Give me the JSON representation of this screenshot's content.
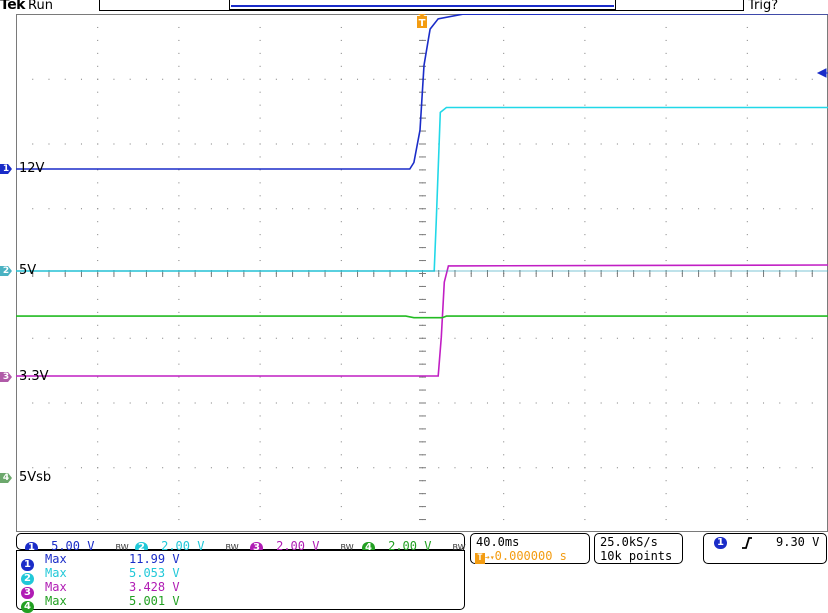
{
  "header": {
    "brand": "Tek",
    "state": "Run",
    "trigger_status": "Trig?"
  },
  "colors": {
    "ch1": "#1a2cc8",
    "ch2": "#21d8e8",
    "ch3": "#c11ec4",
    "ch4": "#22bb22",
    "trigger": "#f39c12",
    "grid": "#7a7a7a"
  },
  "icons": {
    "trigger_marker": "trigger-t-icon",
    "ref_arrow": "left-arrow-icon",
    "edge": "rising-edge-icon"
  },
  "channels": [
    {
      "num": "1",
      "label": "12V",
      "scale": "5.00 V",
      "bw": "BW",
      "color": "#1a2cc8"
    },
    {
      "num": "2",
      "label": "5V",
      "scale": "2.00 V",
      "bw": "BW",
      "color": "#21c8d8"
    },
    {
      "num": "3",
      "label": "3.3V",
      "scale": "2.00 V",
      "bw": "BW",
      "color": "#b01cb4"
    },
    {
      "num": "4",
      "label": "5Vsb",
      "scale": "2.00 V",
      "bw": "BW",
      "color": "#22a022"
    }
  ],
  "timebase": {
    "scale": "40.0ms",
    "trigger_marker": "T",
    "position": "0.000000 s"
  },
  "acquisition": {
    "rate": "25.0kS/s",
    "length": "10k points"
  },
  "trigger": {
    "source": "1",
    "level": "9.30 V"
  },
  "measurements": [
    {
      "num": "1",
      "name": "Max",
      "value": "11.99 V",
      "color": "#1a2cc8"
    },
    {
      "num": "2",
      "name": "Max",
      "value": "5.053 V",
      "color": "#21c8d8"
    },
    {
      "num": "3",
      "name": "Max",
      "value": "3.428 V",
      "color": "#b01cb4"
    },
    {
      "num": "4",
      "name": "Max",
      "value": "5.001 V",
      "color": "#22a022"
    }
  ],
  "chart_data": {
    "type": "line",
    "x_unit": "ms",
    "xlim": [
      -200,
      200
    ],
    "x_divisions": 10,
    "y_divisions": 8,
    "grid": true,
    "series": [
      {
        "name": "12V",
        "channel": "1",
        "points": [
          [
            -200,
            0
          ],
          [
            -6,
            0
          ],
          [
            -4,
            0.5
          ],
          [
            -1,
            3
          ],
          [
            1,
            8
          ],
          [
            4,
            10.8
          ],
          [
            8,
            11.6
          ],
          [
            20,
            11.95
          ],
          [
            200,
            11.99
          ]
        ]
      },
      {
        "name": "5V",
        "channel": "2",
        "points": [
          [
            -200,
            0
          ],
          [
            6,
            0
          ],
          [
            7,
            1.5
          ],
          [
            9,
            4.9
          ],
          [
            12,
            5.05
          ],
          [
            200,
            5.05
          ]
        ]
      },
      {
        "name": "3.3V",
        "channel": "3",
        "points": [
          [
            -200,
            0
          ],
          [
            8,
            0
          ],
          [
            9.5,
            1.2
          ],
          [
            11,
            2.9
          ],
          [
            13,
            3.4
          ],
          [
            200,
            3.43
          ]
        ]
      },
      {
        "name": "5Vsb",
        "channel": "4",
        "points": [
          [
            -200,
            5.0
          ],
          [
            -8,
            5.0
          ],
          [
            -4,
            4.95
          ],
          [
            10,
            4.95
          ],
          [
            12,
            5.0
          ],
          [
            200,
            5.0
          ]
        ]
      }
    ]
  }
}
